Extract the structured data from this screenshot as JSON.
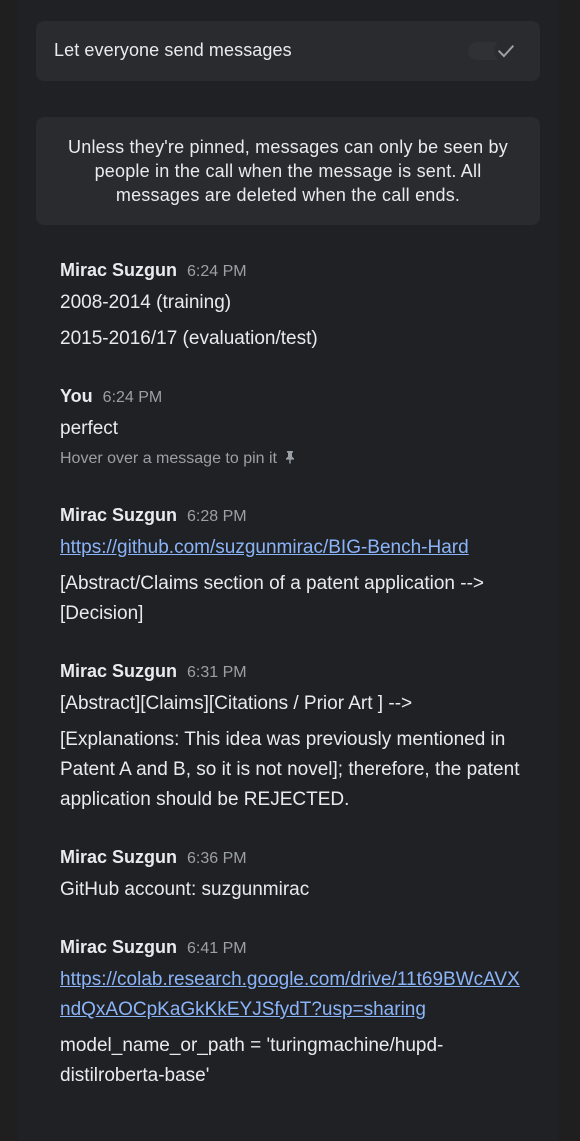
{
  "settings": {
    "send_messages_label": "Let everyone send messages",
    "send_messages_enabled": true
  },
  "notice": {
    "text": "Unless they're pinned, messages can only be seen by people in the call when the message is sent. All messages are deleted when the call ends."
  },
  "messages": [
    {
      "sender": "Mirac Suzgun",
      "time": "6:24 PM",
      "lines": [
        "2008-2014 (training)",
        "2015-2016/17 (evaluation/test)"
      ]
    },
    {
      "sender": "You",
      "time": "6:24 PM",
      "lines": [
        "perfect"
      ],
      "hint": "Hover over a message to pin it"
    },
    {
      "sender": "Mirac Suzgun",
      "time": "6:28 PM",
      "link": "https://github.com/suzgunmirac/BIG-Bench-Hard",
      "lines": [
        "[Abstract/Claims section of a patent application --> [Decision]"
      ]
    },
    {
      "sender": "Mirac Suzgun",
      "time": "6:31 PM",
      "lines": [
        "[Abstract][Claims][Citations / Prior Art ] -->",
        "[Explanations: This idea was previously mentioned in Patent A and B, so it is not novel]; therefore, the patent application should be REJECTED."
      ]
    },
    {
      "sender": "Mirac Suzgun",
      "time": "6:36 PM",
      "lines": [
        "GitHub account: suzgunmirac"
      ]
    },
    {
      "sender": "Mirac Suzgun",
      "time": "6:41 PM",
      "link": "https://colab.research.google.com/drive/11t69BWcAVXndQxAOCpKaGkKkEYJSfydT?usp=sharing",
      "lines": [
        "model_name_or_path = 'turingmachine/hupd-distilroberta-base'"
      ]
    }
  ]
}
